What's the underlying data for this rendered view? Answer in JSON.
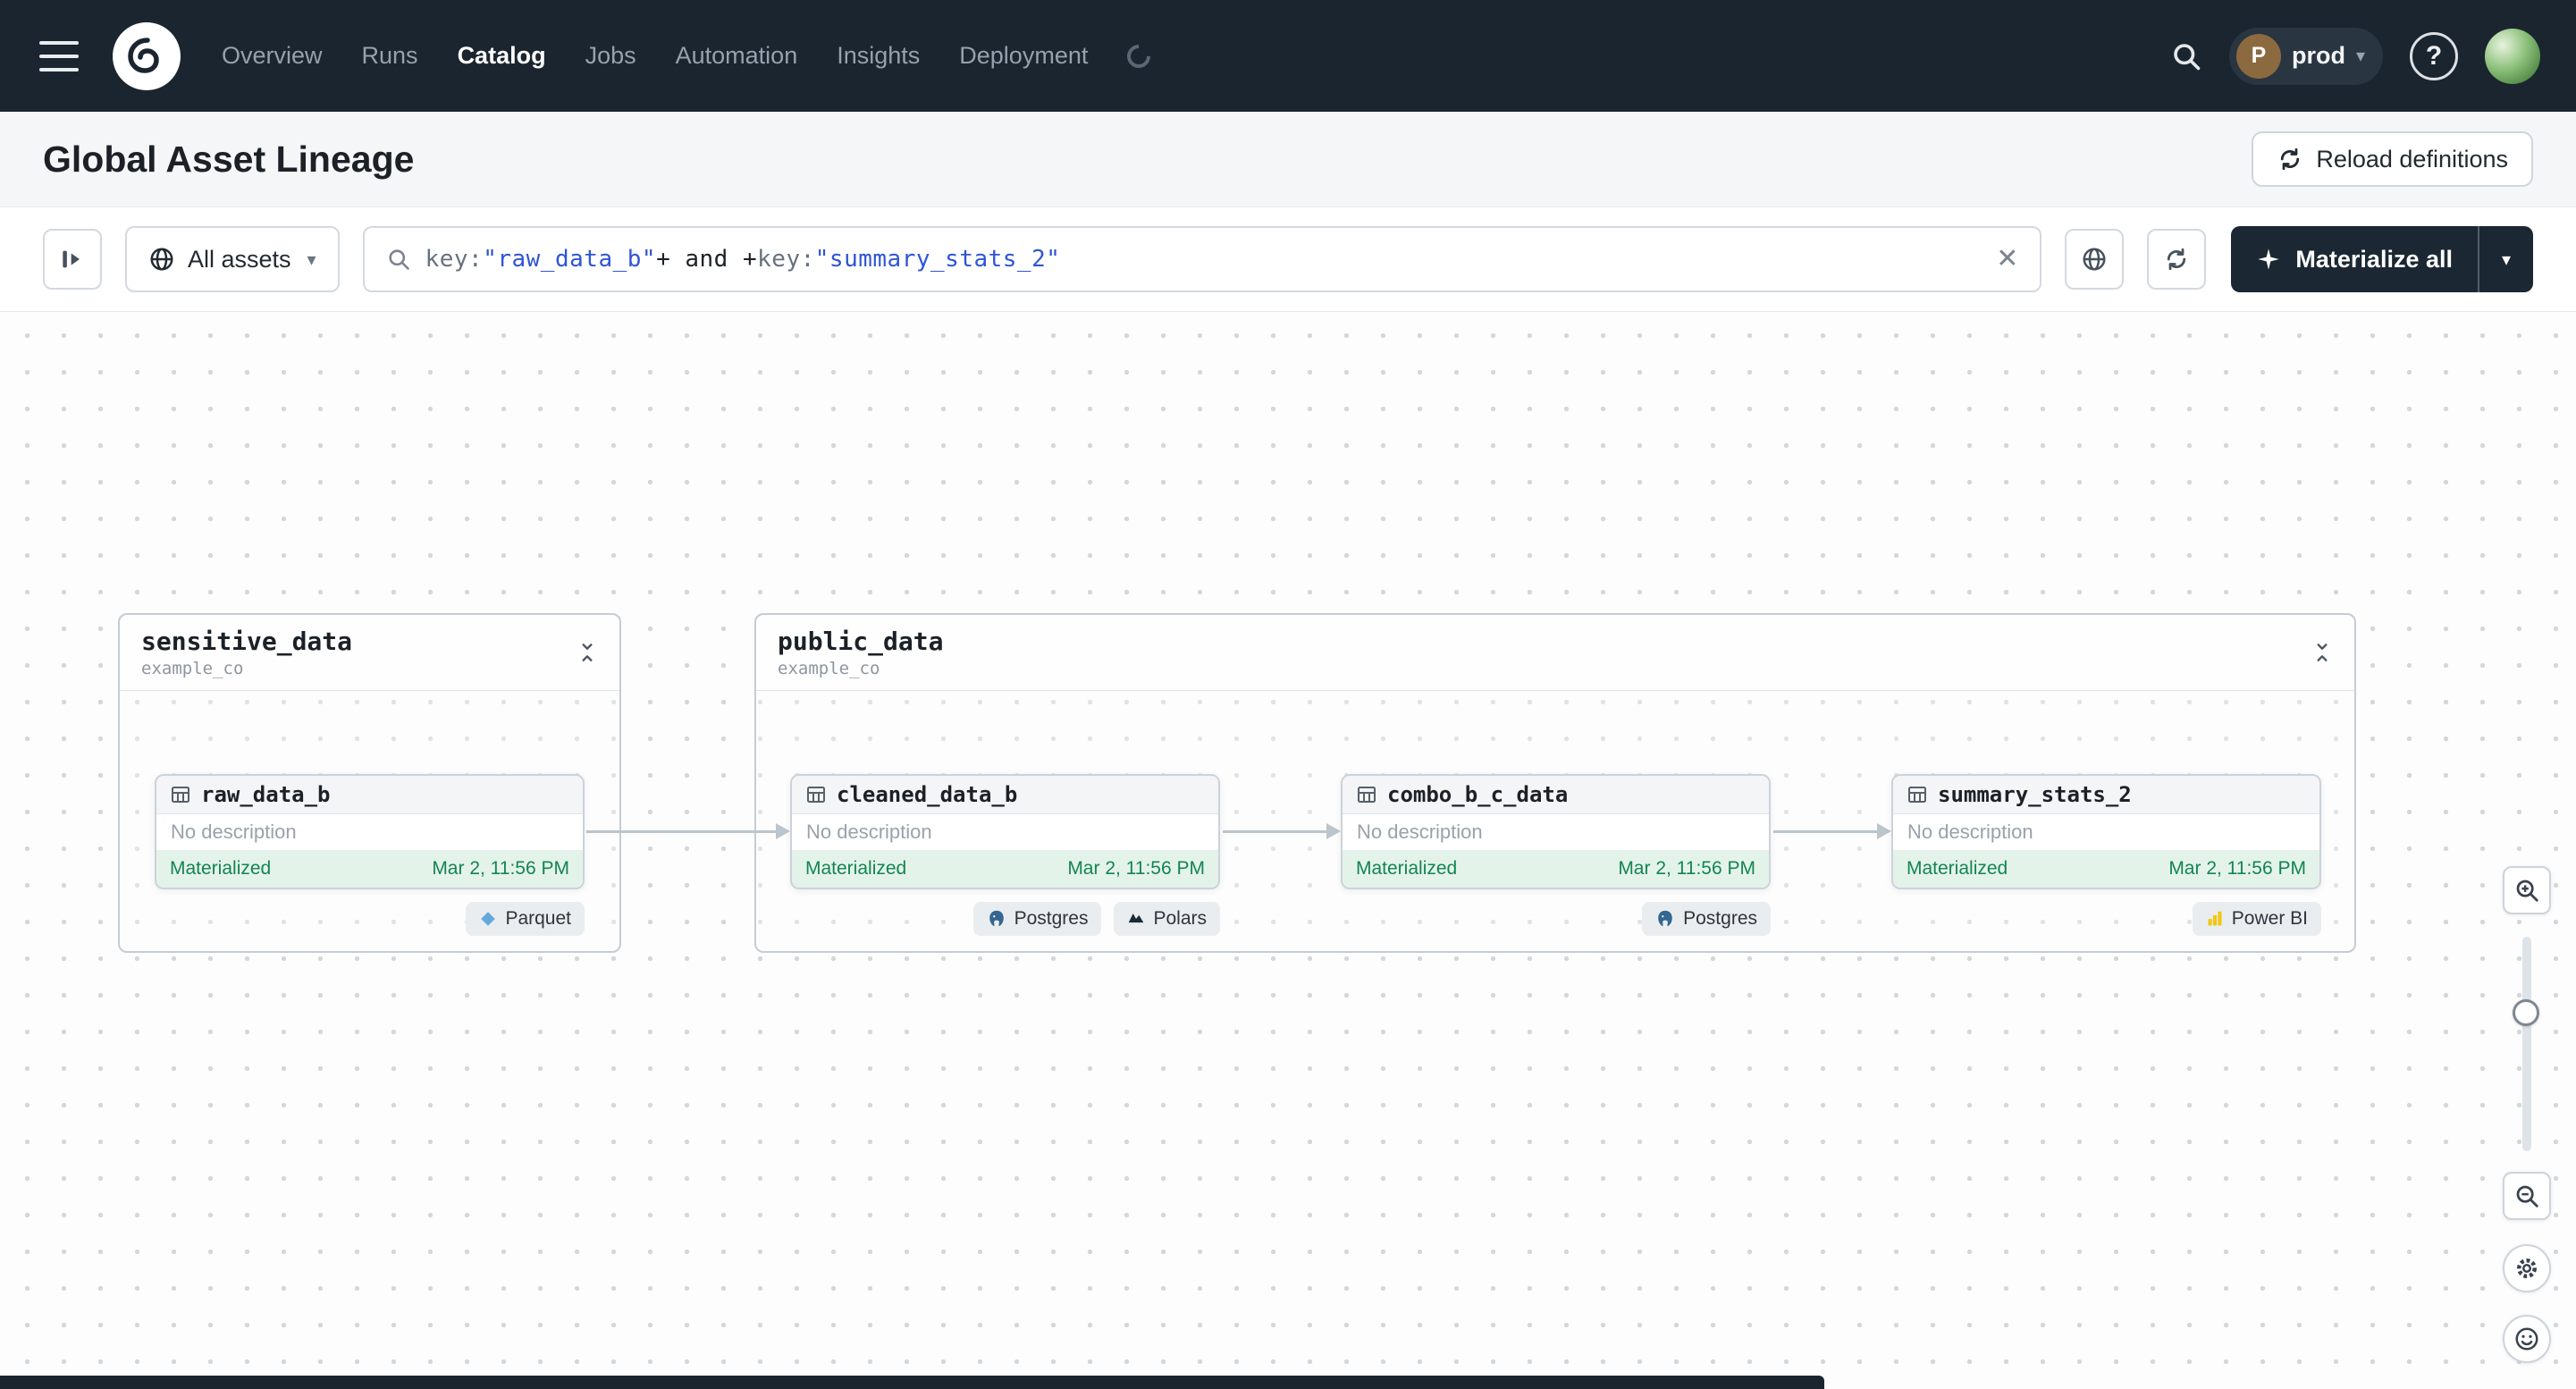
{
  "nav": {
    "items": [
      "Overview",
      "Runs",
      "Catalog",
      "Jobs",
      "Automation",
      "Insights",
      "Deployment"
    ],
    "env": {
      "initial": "P",
      "name": "prod"
    },
    "help_label": "?"
  },
  "page": {
    "title": "Global Asset Lineage",
    "reload_button": "Reload definitions"
  },
  "toolbar": {
    "scope": "All assets",
    "materialize": "Materialize all",
    "query": [
      {
        "text": "key:",
        "type": "plain"
      },
      {
        "text": "\"raw_data_b\"",
        "type": "string"
      },
      {
        "text": "+",
        "type": "op"
      },
      {
        "text": " and ",
        "type": "op"
      },
      {
        "text": "+",
        "type": "op"
      },
      {
        "text": "key:",
        "type": "plain"
      },
      {
        "text": "\"summary_stats_2\"",
        "type": "string"
      }
    ]
  },
  "groups": [
    {
      "name": "sensitive_data",
      "org": "example_co"
    },
    {
      "name": "public_data",
      "org": "example_co"
    }
  ],
  "assets": [
    {
      "name": "raw_data_b",
      "description": "No description",
      "status": "Materialized",
      "materialized_at": "Mar 2, 11:56 PM",
      "badges": [
        {
          "label": "Parquet",
          "icon": "parquet-icon"
        }
      ]
    },
    {
      "name": "cleaned_data_b",
      "description": "No description",
      "status": "Materialized",
      "materialized_at": "Mar 2, 11:56 PM",
      "badges": [
        {
          "label": "Postgres",
          "icon": "postgres-icon"
        },
        {
          "label": "Polars",
          "icon": "polars-icon"
        }
      ]
    },
    {
      "name": "combo_b_c_data",
      "description": "No description",
      "status": "Materialized",
      "materialized_at": "Mar 2, 11:56 PM",
      "badges": [
        {
          "label": "Postgres",
          "icon": "postgres-icon"
        }
      ]
    },
    {
      "name": "summary_stats_2",
      "description": "No description",
      "status": "Materialized",
      "materialized_at": "Mar 2, 11:56 PM",
      "badges": [
        {
          "label": "Power BI",
          "icon": "powerbi-icon"
        }
      ]
    }
  ],
  "colors": {
    "nav_bg": "#1A2530",
    "status_green": "#148452",
    "status_green_bg": "#E4F3EA",
    "query_string_blue": "#2F55D4",
    "parquet_blue": "#64A8DC",
    "postgres_blue": "#336791",
    "powerbi_yellow": "#F2C811"
  }
}
